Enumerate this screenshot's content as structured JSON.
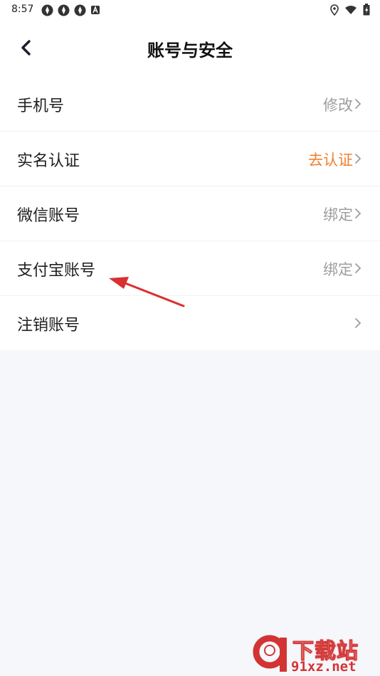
{
  "status_bar": {
    "time": "8:57",
    "left_icons": [
      "app-notification-icon",
      "app-notification-icon",
      "app-notification-icon",
      "a-badge-icon"
    ],
    "right_icons": [
      "location-icon",
      "wifi-icon",
      "battery-charging-icon"
    ]
  },
  "header": {
    "title": "账号与安全",
    "back_icon": "chevron-left-icon"
  },
  "settings": {
    "items": [
      {
        "label": "手机号",
        "action": "修改"
      },
      {
        "label": "实名认证",
        "action": "去认证",
        "action_color": "#f0812f"
      },
      {
        "label": "微信账号",
        "action": "绑定"
      },
      {
        "label": "支付宝账号",
        "action": "绑定"
      },
      {
        "label": "注销账号",
        "action": ""
      }
    ]
  },
  "watermark": {
    "title": "下载站",
    "domain": "91xz.net"
  },
  "colors": {
    "background": "#f6f7fb",
    "accent_orange": "#f0812f",
    "secondary_text": "#9d9d9d",
    "annotation_red": "#d93030"
  }
}
